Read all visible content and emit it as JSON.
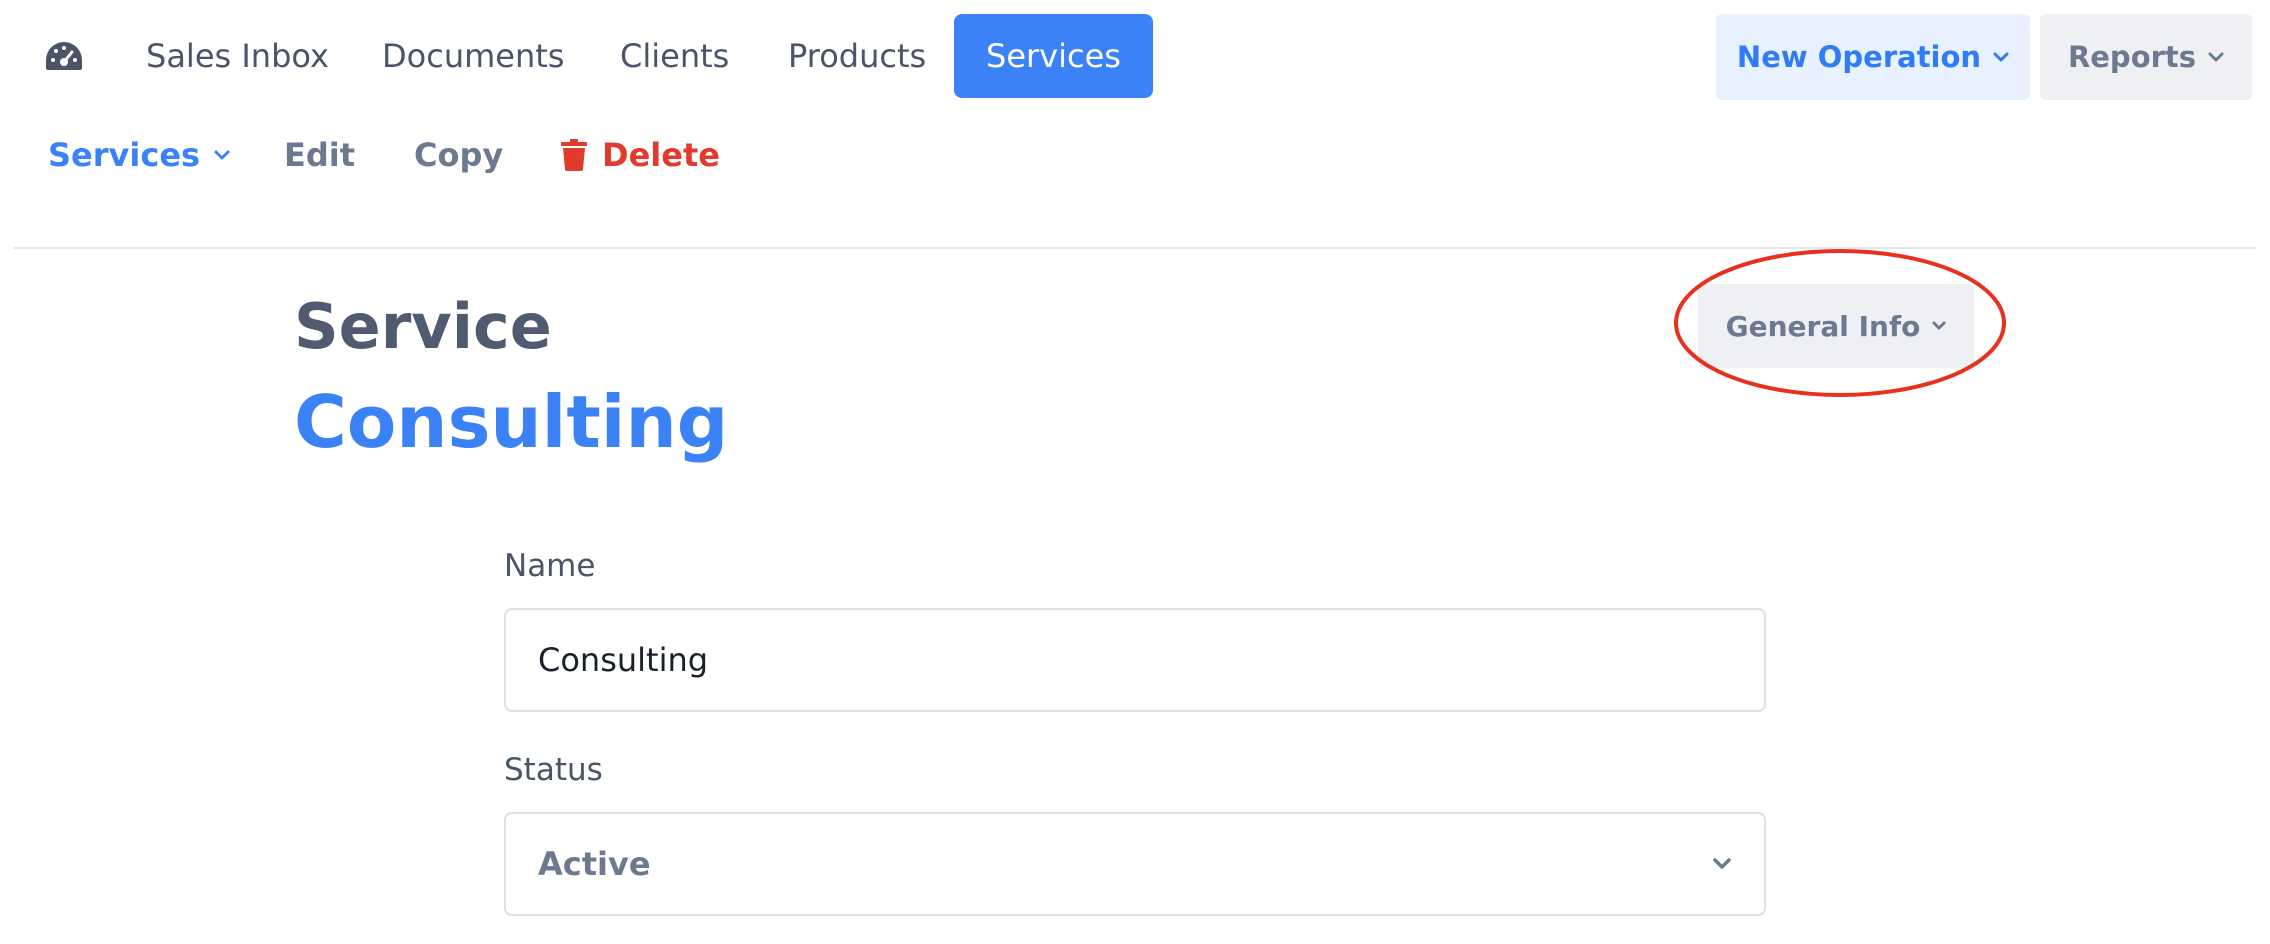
{
  "topnav": {
    "dashboard_icon": "dashboard-gauge-icon",
    "items": [
      {
        "label": "Sales Inbox"
      },
      {
        "label": "Documents"
      },
      {
        "label": "Clients"
      },
      {
        "label": "Products"
      },
      {
        "label": "Services",
        "active": true
      }
    ],
    "new_operation_label": "New Operation",
    "reports_label": "Reports"
  },
  "subnav": {
    "services_label": "Services",
    "edit_label": "Edit",
    "copy_label": "Copy",
    "delete_label": "Delete",
    "delete_icon": "trash-icon"
  },
  "page": {
    "title": "Service",
    "subtitle": "Consulting",
    "general_info_label": "General Info"
  },
  "form": {
    "name_label": "Name",
    "name_value": "Consulting",
    "status_label": "Status",
    "status_value": "Active"
  },
  "colors": {
    "accent": "#3b82f6",
    "danger": "#e03b2c",
    "highlight_ring": "#e8301f"
  }
}
